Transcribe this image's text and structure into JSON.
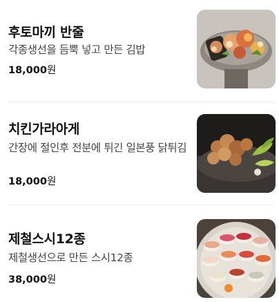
{
  "menu": {
    "items": [
      {
        "name": "후토마끼 반줄",
        "description": "각종생선을 듬뿍 넣고 만든 김밥",
        "price_amount": "18,000",
        "price_unit": "원",
        "image": "futomaki-photo"
      },
      {
        "name": "치킨가라아게",
        "description": "간장에 절인후 전분에 튀긴 일본풍 닭튀김",
        "price_amount": "18,000",
        "price_unit": "원",
        "image": "chicken-karaage-photo"
      },
      {
        "name": "제철스시12종",
        "description": "제철생선으로 만든 스시12종",
        "price_amount": "38,000",
        "price_unit": "원",
        "image": "sushi-platter-photo"
      }
    ]
  },
  "colors": {
    "text_primary": "#111111",
    "text_secondary": "#444444",
    "divider": "#eeeeee",
    "background": "#ffffff"
  }
}
